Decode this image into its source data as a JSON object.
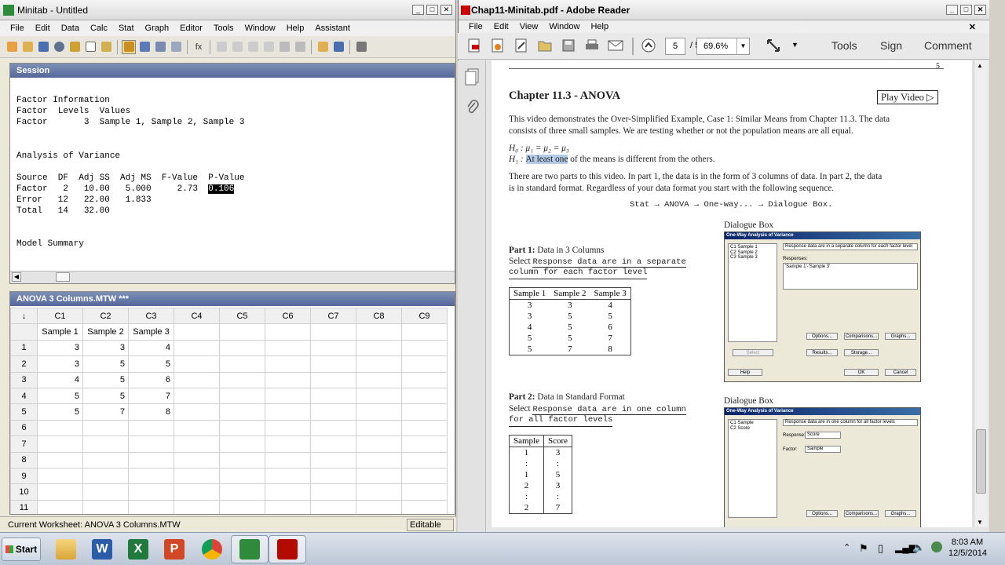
{
  "minitab": {
    "title": "Minitab - Untitled",
    "menu": [
      "File",
      "Edit",
      "Data",
      "Calc",
      "Stat",
      "Graph",
      "Editor",
      "Tools",
      "Window",
      "Help",
      "Assistant"
    ],
    "session_title": "Session",
    "session_lines": [
      "Factor Information",
      "",
      "Factor  Levels  Values",
      "Factor       3  Sample 1, Sample 2, Sample 3",
      "",
      "",
      "Analysis of Variance",
      "",
      "Source  DF  Adj SS  Adj MS  F-Value  P-Value",
      "Factor   2   10.00   5.000     2.73     0.106",
      "Error   12   22.00   1.833",
      "Total   14   32.00",
      "",
      "",
      "Model Summary"
    ],
    "pvalue": "0.106",
    "worksheet_title": "ANOVA 3 Columns.MTW ***",
    "col_headers": [
      "↓",
      "C1",
      "C2",
      "C3",
      "C4",
      "C5",
      "C6",
      "C7",
      "C8",
      "C9"
    ],
    "col_names": [
      "Sample 1",
      "Sample 2",
      "Sample 3"
    ],
    "rows": [
      [
        "1",
        "3",
        "3",
        "4"
      ],
      [
        "2",
        "3",
        "5",
        "5"
      ],
      [
        "3",
        "4",
        "5",
        "6"
      ],
      [
        "4",
        "5",
        "5",
        "7"
      ],
      [
        "5",
        "5",
        "7",
        "8"
      ],
      [
        "6",
        "",
        "",
        ""
      ],
      [
        "7",
        "",
        "",
        ""
      ],
      [
        "8",
        "",
        "",
        ""
      ],
      [
        "9",
        "",
        "",
        ""
      ],
      [
        "10",
        "",
        "",
        ""
      ],
      [
        "11",
        "",
        "",
        ""
      ]
    ],
    "status_text": "Current Worksheet: ANOVA 3 Columns.MTW",
    "status_mode": "Editable"
  },
  "reader": {
    "title": "Chap11-Minitab.pdf - Adobe Reader",
    "menu": [
      "File",
      "Edit",
      "View",
      "Window",
      "Help"
    ],
    "page_current": "5",
    "page_total": "/ 5",
    "zoom": "69.6%",
    "tools_label": "Tools",
    "sign_label": "Sign",
    "comment_label": "Comment",
    "page_num": "5",
    "heading": "Chapter 11.3 - ANOVA",
    "play_video": "Play Video ▷",
    "intro_l1": "This video demonstrates the Over-Simplified Example, Case 1: Similar Means from Chapter 11.3.  The data",
    "intro_l2": "consists of three small samples.  We are testing whether or not the population means are all equal.",
    "h0": "H₀ : μ₁ = μ₂ = μ₃",
    "h1_prefix": "H₁ : ",
    "h1_sel": "At least one",
    "h1_rest": " of the means is different from the others.",
    "parts_l1": "There are two parts to this video.  In part 1, the data is in the form of 3 columns of data.  In part 2, the data",
    "parts_l2": "is in standard format.  Regardless of your data format you start with the following sequence.",
    "sequence": "Stat → ANOVA → One-way... → Dialogue Box.",
    "part1_head": "Part 1:",
    "part1_title": " Data in 3 Columns",
    "select_word": "Select ",
    "part1_opt_a": "Response data are in a separate",
    "part1_opt_b": "column for each factor level",
    "p1_headers": [
      "Sample 1",
      "Sample 2",
      "Sample 3"
    ],
    "p1_rows": [
      [
        "3",
        "3",
        "4"
      ],
      [
        "3",
        "5",
        "5"
      ],
      [
        "4",
        "5",
        "6"
      ],
      [
        "5",
        "5",
        "7"
      ],
      [
        "5",
        "7",
        "8"
      ]
    ],
    "part2_head": "Part 2:",
    "part2_title": " Data in Standard Format",
    "part2_opt_a": "Response data are in one column",
    "part2_opt_b": "for all factor levels",
    "p2_headers": [
      "Sample",
      "Score"
    ],
    "p2_rows": [
      [
        "1",
        "3"
      ],
      [
        ":",
        ":"
      ],
      [
        "1",
        "5"
      ],
      [
        "2",
        "3"
      ],
      [
        ":",
        ":"
      ],
      [
        "2",
        "7"
      ]
    ],
    "dialogue_label": "Dialogue Box",
    "dlg_title": "One-Way Analysis of Variance",
    "dlg1_vars": [
      "C1  Sample 1",
      "C2  Sample 2",
      "C3  Sample 3"
    ],
    "dlg1_combo": "Response data are in a separate column for each factor level",
    "dlg1_responses_label": "Responses:",
    "dlg1_responses": "'Sample 1'-'Sample 3'",
    "dlg2_vars": [
      "C1  Sample",
      "C2  Score"
    ],
    "dlg2_combo": "Response data are in one column for all factor levels",
    "dlg2_response_label": "Response:",
    "dlg2_response": "Score",
    "dlg2_factor_label": "Factor:",
    "dlg2_factor": "Sample",
    "dlg_btns": {
      "options": "Options...",
      "comparisons": "Comparisons...",
      "graphs": "Graphs...",
      "results": "Results...",
      "storage": "Storage...",
      "select": "Select",
      "help": "Help",
      "ok": "OK",
      "cancel": "Cancel"
    }
  },
  "taskbar": {
    "start": "Start",
    "time": "8:03 AM",
    "date": "12/5/2014"
  }
}
